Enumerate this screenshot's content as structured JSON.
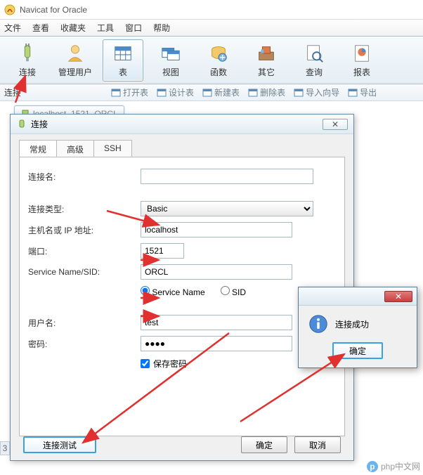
{
  "app": {
    "title": "Navicat for Oracle"
  },
  "menu": {
    "file": "文件",
    "view": "查看",
    "favorites": "收藏夹",
    "tools": "工具",
    "window": "窗口",
    "help": "帮助"
  },
  "ribbon": {
    "connect": "连接",
    "users": "管理用户",
    "table": "表",
    "view": "视图",
    "function": "函数",
    "other": "其它",
    "query": "查询",
    "report": "报表"
  },
  "subtoolbar": {
    "section": "连接",
    "open_table": "打开表",
    "design_table": "设计表",
    "new_table": "新建表",
    "delete_table": "删除表",
    "import_wizard": "导入向导",
    "export_wizard": "导出"
  },
  "tree_tab": {
    "label": "localhost_1521_ORCL"
  },
  "dialog": {
    "title": "连接",
    "tabs": {
      "general": "常规",
      "advanced": "高级",
      "ssh": "SSH"
    },
    "labels": {
      "conn_name": "连接名:",
      "conn_type": "连接类型:",
      "host": "主机名或 IP 地址:",
      "port": "端口:",
      "service_sid": "Service Name/SID:",
      "user": "用户名:",
      "password": "密码:"
    },
    "values": {
      "conn_name": "",
      "conn_type": "Basic",
      "host": "localhost",
      "port": "1521",
      "service": "ORCL",
      "user": "test",
      "password": "●●●●"
    },
    "radios": {
      "service_name": "Service Name",
      "sid": "SID"
    },
    "save_password": "保存密码",
    "buttons": {
      "test": "连接测试",
      "ok": "确定",
      "cancel": "取消"
    }
  },
  "msgbox": {
    "text": "连接成功",
    "ok": "确定"
  },
  "watermark": {
    "text": "php中文网"
  },
  "misc": {
    "close_glyph": "✕",
    "collapse_glyph": "3"
  }
}
